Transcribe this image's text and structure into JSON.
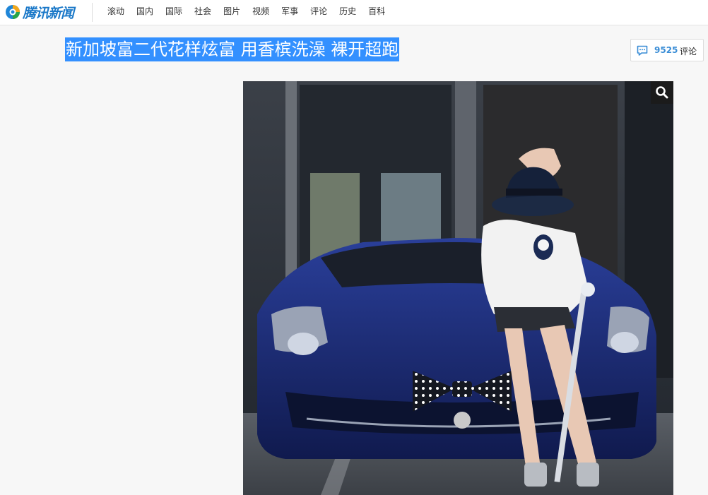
{
  "header": {
    "logo_text": "腾讯新闻",
    "nav": [
      {
        "label": "滚动"
      },
      {
        "label": "国内"
      },
      {
        "label": "国际"
      },
      {
        "label": "社会"
      },
      {
        "label": "图片"
      },
      {
        "label": "视频"
      },
      {
        "label": "军事"
      },
      {
        "label": "评论"
      },
      {
        "label": "历史"
      },
      {
        "label": "百科"
      }
    ]
  },
  "article": {
    "title": "新加坡富二代花样炫富 用香槟洗澡 裸开超跑"
  },
  "comments": {
    "count": "9525",
    "label": "评论",
    "icon": "comment-bubble-icon"
  },
  "photo": {
    "zoom_icon": "magnifier-icon"
  },
  "colors": {
    "brand_blue": "#1a78c8",
    "title_highlight": "#3390ff",
    "comment_count": "#3a8dd6"
  }
}
